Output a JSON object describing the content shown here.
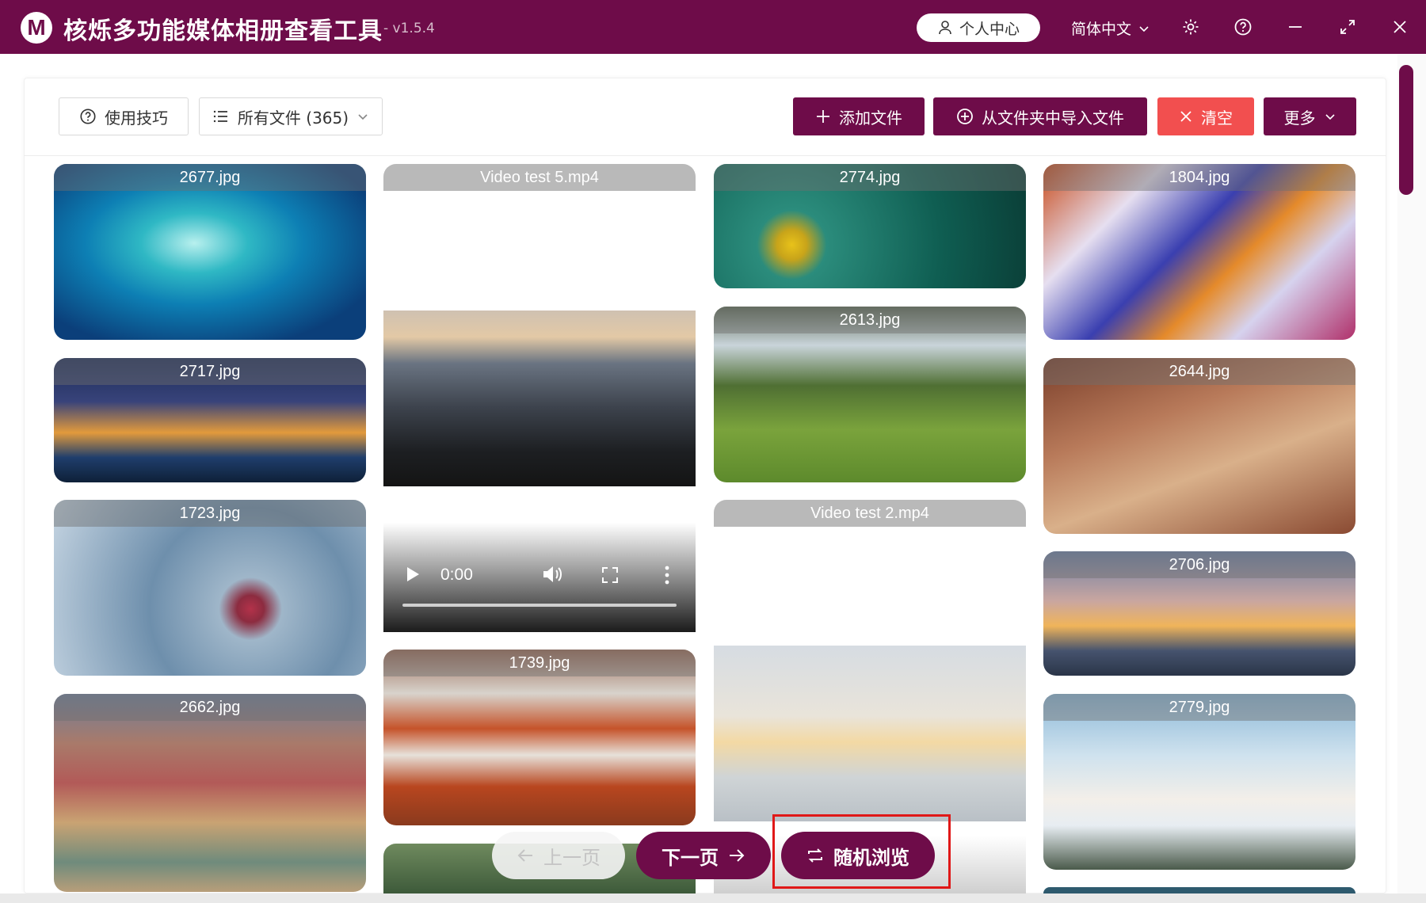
{
  "app": {
    "logo_letter": "M",
    "title": "核烁多功能媒体相册查看工具",
    "version": "- v1.5.4",
    "profile_label": "个人中心",
    "language": "简体中文"
  },
  "toolbar": {
    "tips_label": "使用技巧",
    "filter_label": "所有文件 (365)",
    "add_files_label": "添加文件",
    "import_folder_label": "从文件夹中导入文件",
    "clear_label": "清空",
    "more_label": "更多"
  },
  "gallery": {
    "tiles": [
      {
        "caption": "2677.jpg"
      },
      {
        "caption": "Video test 5.mp4"
      },
      {
        "caption": "2774.jpg"
      },
      {
        "caption": "1804.jpg"
      },
      {
        "caption": "2717.jpg"
      },
      {
        "caption": "2613.jpg"
      },
      {
        "caption": "2644.jpg"
      },
      {
        "caption": "1723.jpg"
      },
      {
        "caption": "Video test 2.mp4"
      },
      {
        "caption": "2706.jpg"
      },
      {
        "caption": "2662.jpg"
      },
      {
        "caption": "1739.jpg"
      },
      {
        "caption": "2779.jpg"
      }
    ],
    "video_player": {
      "time": "0:00"
    }
  },
  "pager": {
    "prev_label": "上一页",
    "next_label": "下一页",
    "random_label": "随机浏览"
  },
  "colors": {
    "brand": "#6e0c49",
    "danger": "#f24f4f",
    "highlight": "#e01818"
  }
}
